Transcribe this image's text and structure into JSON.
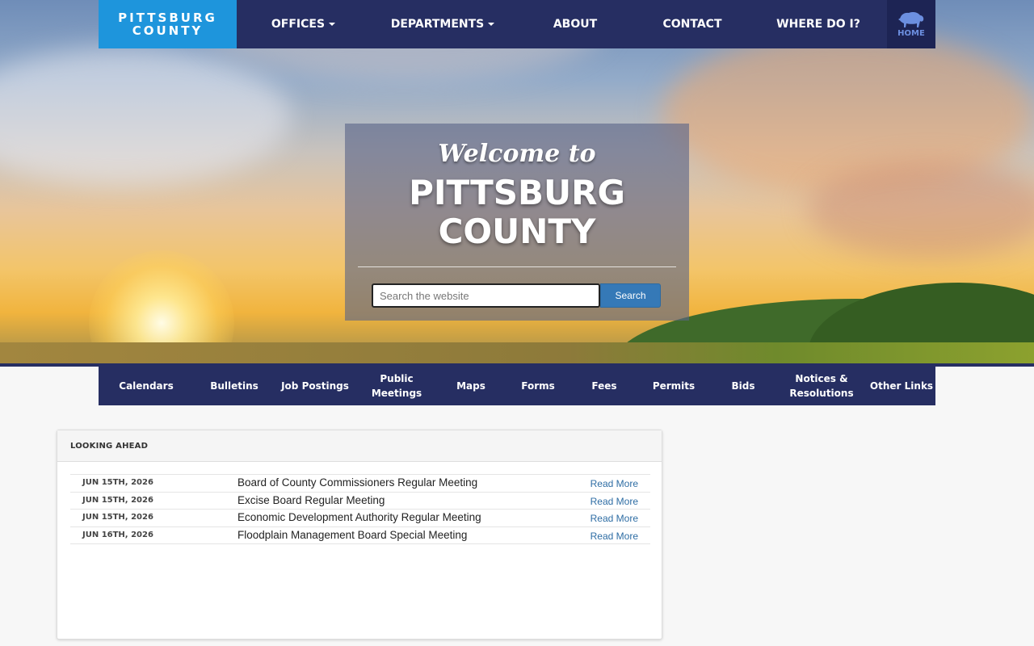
{
  "brand": {
    "line1": "PITTSBURG",
    "line2": "COUNTY"
  },
  "top_nav": {
    "items": [
      {
        "label": "OFFICES",
        "dropdown": true
      },
      {
        "label": "DEPARTMENTS",
        "dropdown": true
      },
      {
        "label": "ABOUT",
        "dropdown": false
      },
      {
        "label": "CONTACT",
        "dropdown": false
      },
      {
        "label": "WHERE DO I?",
        "dropdown": false
      }
    ],
    "home_label": "HOME",
    "home_icon": "bison-icon"
  },
  "welcome": {
    "greeting": "Welcome to",
    "line1": "PITTSBURG",
    "line2": "COUNTY"
  },
  "search": {
    "placeholder": "Search the website",
    "value": "",
    "button_label": "Search"
  },
  "quick_links": [
    "Calendars",
    "Bulletins",
    "Job Postings",
    "Public Meetings",
    "Maps",
    "Forms",
    "Fees",
    "Permits",
    "Bids",
    "Notices &\nResolutions",
    "Other Links"
  ],
  "looking_ahead": {
    "title": "LOOKING AHEAD",
    "events": [
      {
        "date": "JUN 15TH, 2026",
        "title": "Board of County Commissioners Regular Meeting",
        "link": "Read More"
      },
      {
        "date": "JUN 15TH, 2026",
        "title": "Excise Board Regular Meeting",
        "link": "Read More"
      },
      {
        "date": "JUN 15TH, 2026",
        "title": "Economic Development Authority Regular Meeting",
        "link": "Read More"
      },
      {
        "date": "JUN 16TH, 2026",
        "title": "Floodplain Management Board Special Meeting",
        "link": "Read More"
      }
    ]
  },
  "colors": {
    "nav_bg": "#262e62",
    "brand_bg": "#1e95dc",
    "home_bg": "#1d2454",
    "search_button": "#3579b7",
    "link": "#2e6da4"
  }
}
